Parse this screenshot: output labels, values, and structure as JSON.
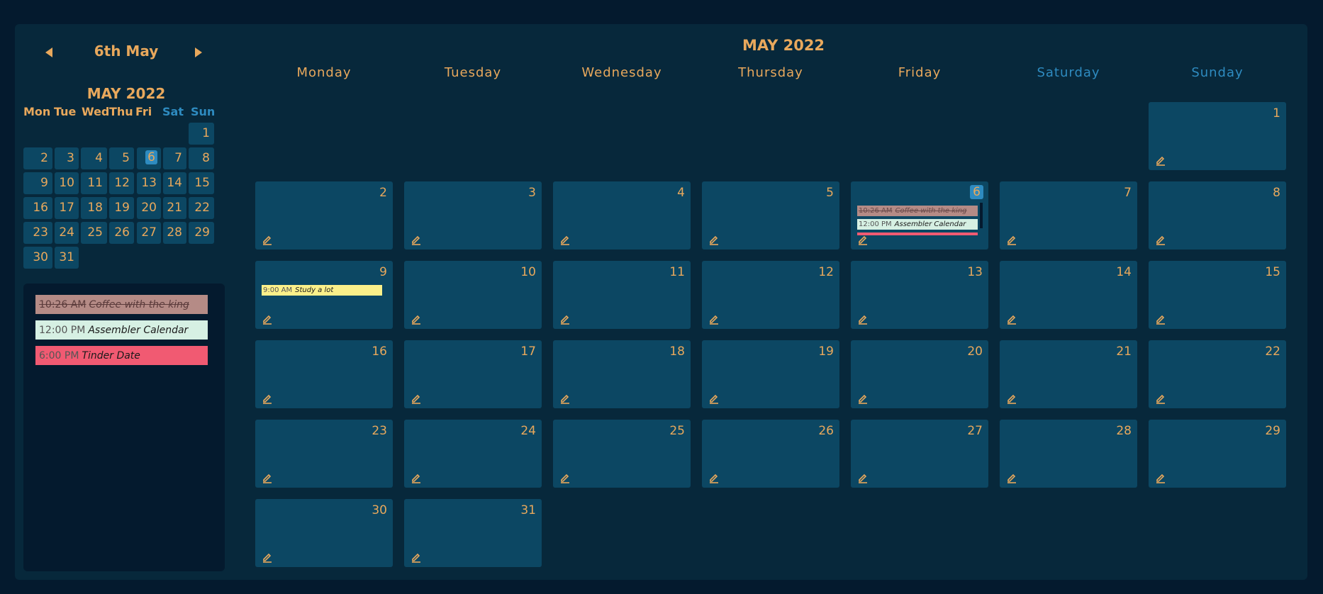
{
  "sidebar": {
    "current_date": "6th May",
    "mini_title": "MAY 2022",
    "weekdays": [
      "Mon",
      "Tue",
      "Wed",
      "Thu",
      "Fri",
      "Sat",
      "Sun"
    ],
    "selected_day": "6",
    "agenda": [
      {
        "time": "10:26 AM",
        "title": "Coffee with the king",
        "color": "#b58b86",
        "done": true
      },
      {
        "time": "12:00 PM",
        "title": "Assembler Calendar",
        "color": "#d6f0e3",
        "done": false
      },
      {
        "time": "6:00 PM",
        "title": "Tinder Date",
        "color": "#f15a72",
        "done": false
      }
    ]
  },
  "main": {
    "title": "MAY 2022",
    "weekdays": [
      "Monday",
      "Tuesday",
      "Wednesday",
      "Thursday",
      "Friday",
      "Saturday",
      "Sunday"
    ],
    "days": [
      "1",
      "2",
      "3",
      "4",
      "5",
      "6",
      "7",
      "8",
      "9",
      "10",
      "11",
      "12",
      "13",
      "14",
      "15",
      "16",
      "17",
      "18",
      "19",
      "20",
      "21",
      "22",
      "23",
      "24",
      "25",
      "26",
      "27",
      "28",
      "29",
      "30",
      "31"
    ],
    "first_weekday_index": 6,
    "today": "6",
    "events": {
      "6": [
        {
          "time": "10:26 AM",
          "title": "Coffee with the king",
          "color": "#b58b86",
          "done": true
        },
        {
          "time": "12:00 PM",
          "title": "Assembler Calendar",
          "color": "#d6f0e3",
          "done": false
        },
        {
          "time": "",
          "title": "",
          "color": "#f15a72",
          "done": false
        }
      ],
      "9": [
        {
          "time": "9:00 AM",
          "title": "Study a lot",
          "color": "#fbf08a",
          "done": false
        }
      ]
    }
  },
  "colors": {
    "background": "#041a2e",
    "panel": "#07283b",
    "cell": "#0c4763",
    "accent_orange": "#e8a85c",
    "accent_blue": "#2e8bc0"
  },
  "icons": {
    "prev": "triangle-left-icon",
    "next": "triangle-right-icon",
    "edit": "pencil-icon"
  }
}
